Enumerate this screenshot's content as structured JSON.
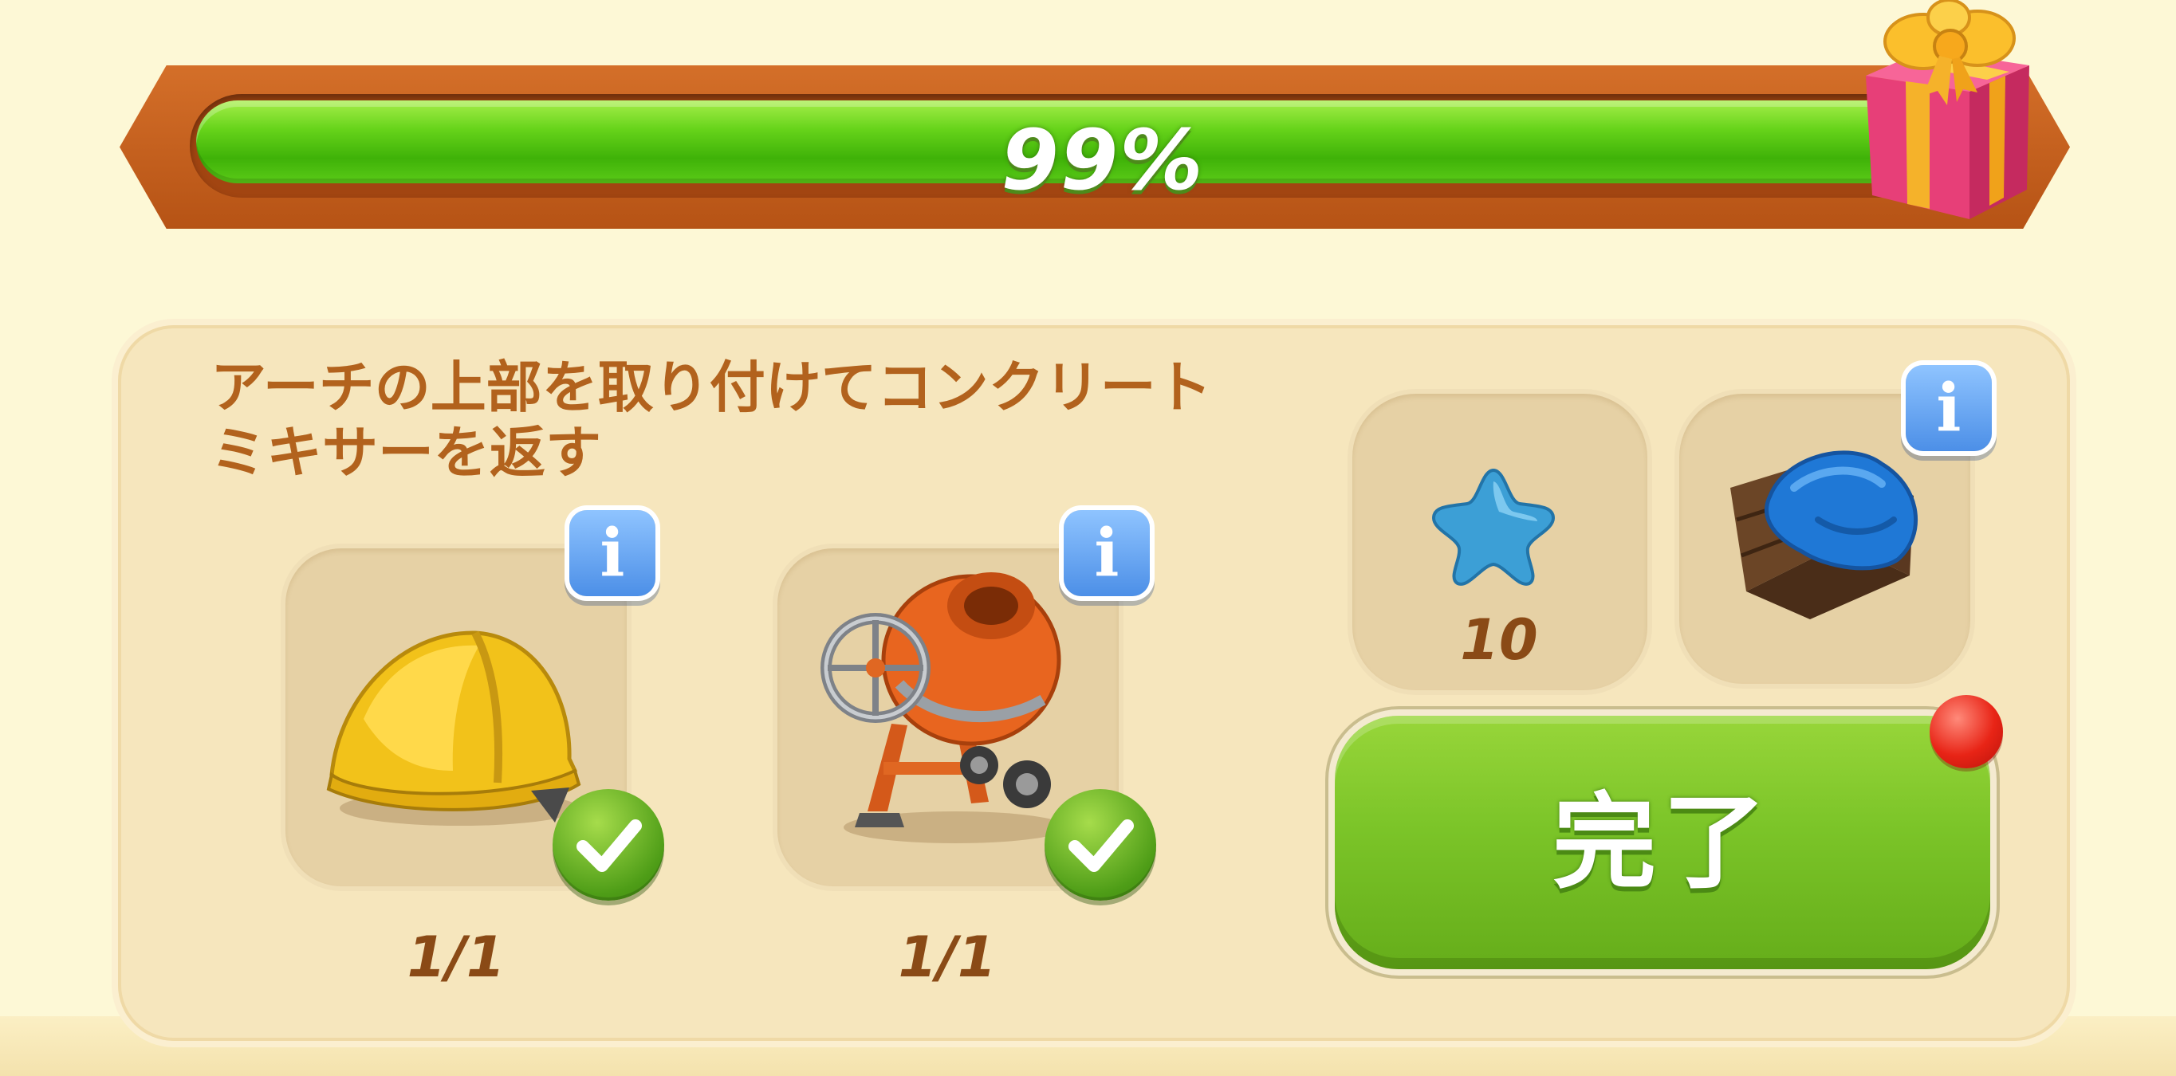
{
  "progress": {
    "value_percent": 99,
    "label": "99%",
    "colors": {
      "frame": "#c8641f",
      "fill": "#5bcb18"
    }
  },
  "reward_icon": "gift-box-icon",
  "task": {
    "title_line1": "アーチの上部を取り付けてコンクリート",
    "title_line2": "ミキサーを返す",
    "requirements": [
      {
        "icon": "hard-hat-icon",
        "count": "1/1",
        "completed": true
      },
      {
        "icon": "cement-mixer-icon",
        "count": "1/1",
        "completed": true
      }
    ]
  },
  "rewards": [
    {
      "icon": "blue-star-icon",
      "amount": "10"
    },
    {
      "icon": "blue-cloth-crate-icon"
    }
  ],
  "complete_button": {
    "label": "完了",
    "color": "#7bc428"
  },
  "notification_color": "#e82416"
}
